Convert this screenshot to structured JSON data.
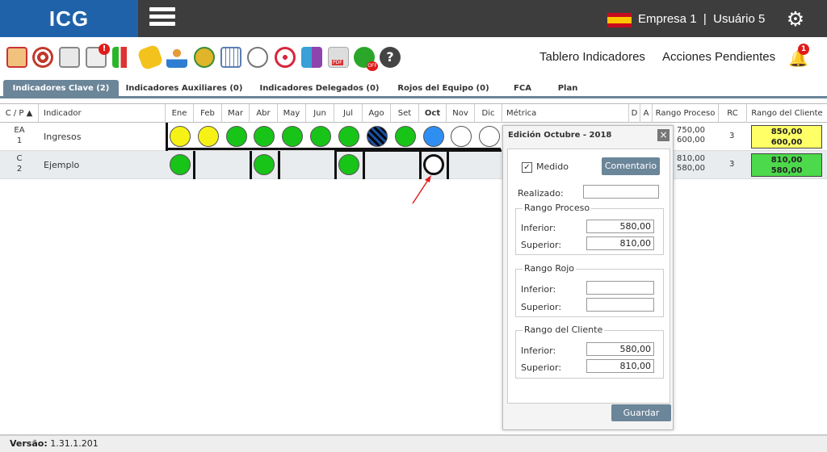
{
  "header": {
    "logo": "ICG",
    "company": "Empresa 1",
    "separator": "|",
    "user": "Usuário 5"
  },
  "toolbar": {
    "icons": [
      "edit-icon",
      "target-icon",
      "clipboard-icon",
      "alert-chart-icon",
      "chart-down-icon",
      "paperclip-icon",
      "team-icon",
      "award-icon",
      "calendar-icon",
      "stopwatch-icon",
      "crosshair-icon",
      "puzzle-icon",
      "pdf-icon",
      "off-icon",
      "help-icon"
    ],
    "links": {
      "dashboard": "Tablero Indicadores",
      "pending": "Acciones Pendientes"
    },
    "bell_count": "1"
  },
  "tabs": [
    "Indicadores Clave (2)",
    "Indicadores Auxiliares (0)",
    "Indicadores Delegados (0)",
    "Rojos del Equipo (0)",
    "FCA",
    "Plan"
  ],
  "columns": {
    "cp": "C / P",
    "indicator": "Indicador",
    "months": [
      "Ene",
      "Feb",
      "Mar",
      "Abr",
      "May",
      "Jun",
      "Jul",
      "Ago",
      "Set",
      "Oct",
      "Nov",
      "Dic"
    ],
    "metric": "Métrica",
    "d": "D",
    "a": "A",
    "process_range": "Rango Proceso",
    "rc": "RC",
    "client_range": "Rango del Cliente"
  },
  "rows": [
    {
      "cp1": "EA",
      "cp2": "1",
      "name": "Ingresos",
      "process": [
        "750,00",
        "600,00"
      ],
      "rc": "3",
      "client": [
        "850,00",
        "600,00"
      ],
      "client_color": "#ffff66"
    },
    {
      "cp1": "C",
      "cp2": "2",
      "name": "Ejemplo",
      "process": [
        "810,00",
        "580,00"
      ],
      "rc": "3",
      "client": [
        "810,00",
        "580,00"
      ],
      "client_color": "#4cd94c"
    }
  ],
  "modal": {
    "title": "Edición Octubre - 2018",
    "close": "×",
    "measured_label": "Medido",
    "comment_button": "Comentario",
    "realized_label": "Realizado:",
    "process_legend": "Rango Proceso",
    "inferior_label": "Inferior:",
    "superior_label": "Superior:",
    "process_inferior": "580,00",
    "process_superior": "810,00",
    "red_legend": "Rango Rojo",
    "client_legend": "Rango del Cliente",
    "client_inferior": "580,00",
    "client_superior": "810,00",
    "save_button": "Guardar"
  },
  "footer": {
    "version_label": "Versão:",
    "version": "1.31.1.201"
  }
}
